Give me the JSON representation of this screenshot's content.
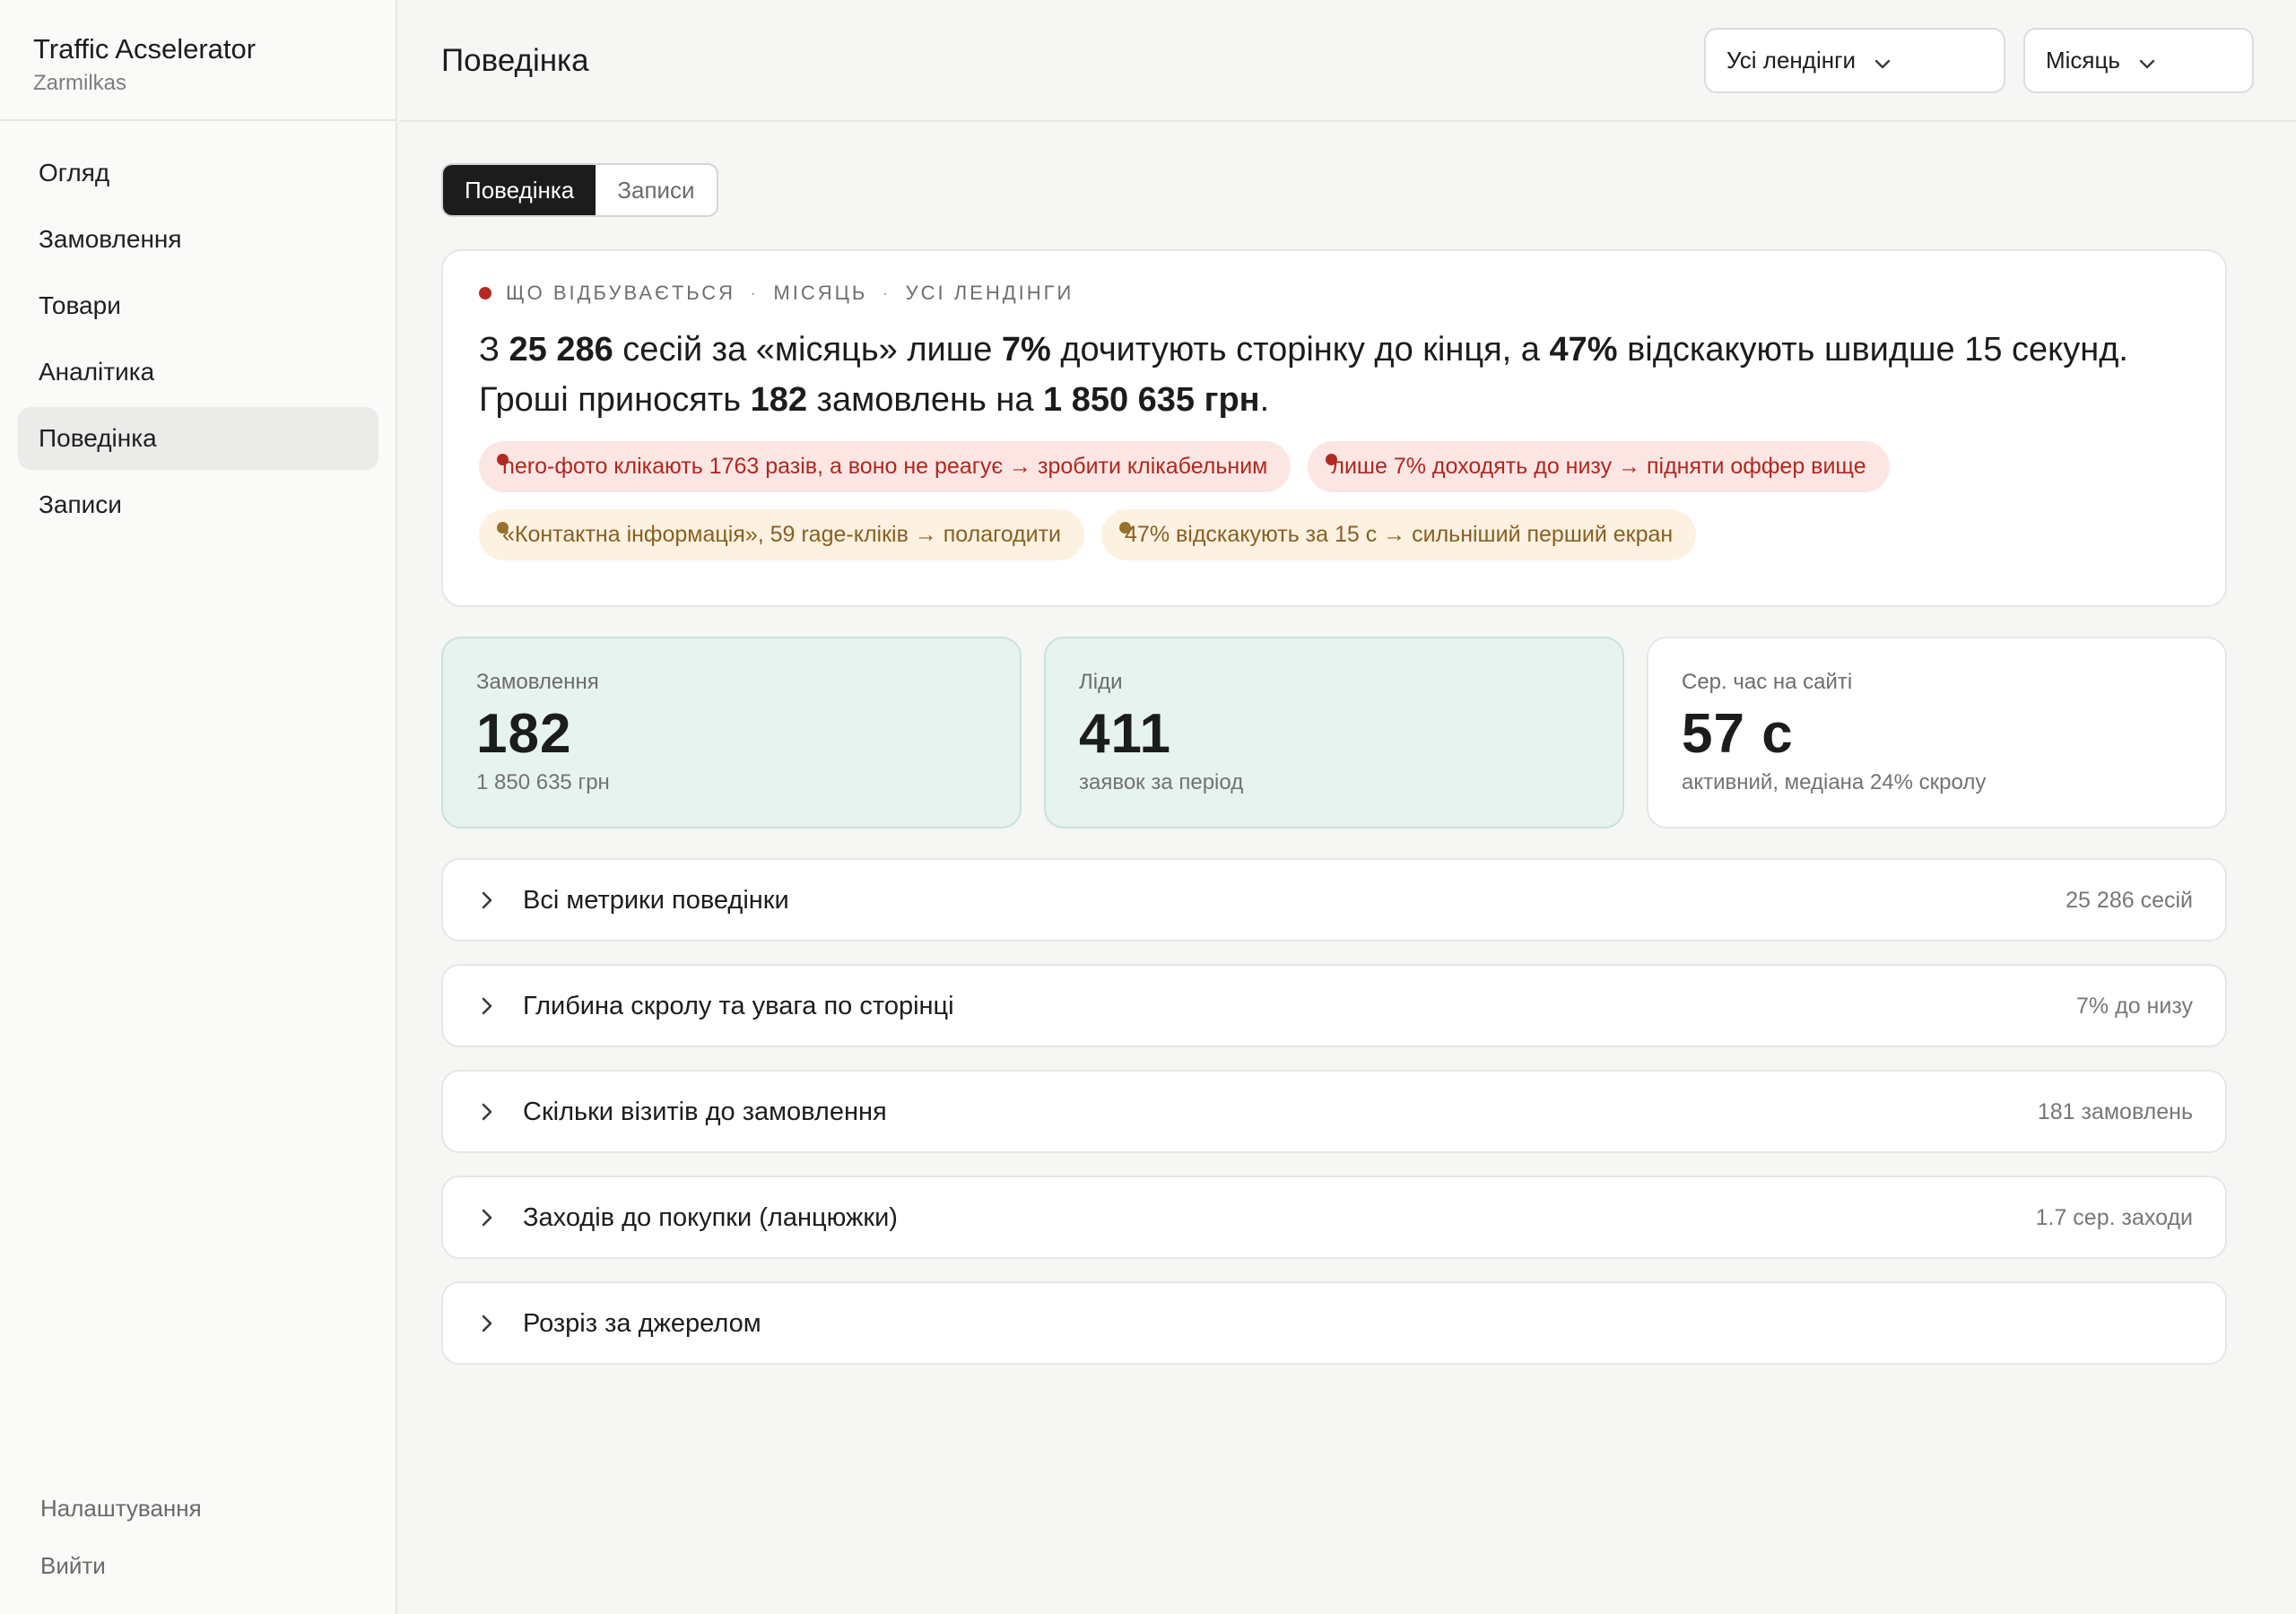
{
  "app": {
    "title": "Traffic Acselerator",
    "subtitle": "Zarmilkas"
  },
  "sidebar": {
    "items": [
      {
        "label": "Огляд",
        "active": false
      },
      {
        "label": "Замовлення",
        "active": false
      },
      {
        "label": "Товари",
        "active": false
      },
      {
        "label": "Аналітика",
        "active": false
      },
      {
        "label": "Поведінка",
        "active": true
      },
      {
        "label": "Записи",
        "active": false
      }
    ],
    "footer": {
      "settings": "Налаштування",
      "logout": "Вийти"
    }
  },
  "header": {
    "title": "Поведінка",
    "landing_select": "Усі лендінги",
    "period_select": "Місяць"
  },
  "tabs": [
    {
      "label": "Поведінка",
      "active": true
    },
    {
      "label": "Записи",
      "active": false
    }
  ],
  "summary": {
    "eyebrow": [
      "ЩО ВІДБУВАЄТЬСЯ",
      "МІСЯЦЬ",
      "УСІ ЛЕНДІНГИ"
    ],
    "headline": {
      "p1": "З ",
      "sessions": "25 286",
      "p2": " сесій за «місяць» лише ",
      "read_pct": "7%",
      "p3": " дочитують сторінку до кінця, а ",
      "bounce_pct": "47%",
      "p4": " відскакують швидше 15 секунд. Гроші приносять ",
      "orders": "182",
      "p5": " замовлень на ",
      "revenue": "1 850 635 грн",
      "p6": "."
    },
    "chips": [
      {
        "text": "hero-фото клікають 1763 разів, а воно не реагує → зробити клікабельним",
        "tone": "red"
      },
      {
        "text": "лише 7% доходять до низу → підняти оффер вище",
        "tone": "red"
      },
      {
        "text": "«Контактна інформація», 59 rage-кліків → полагодити",
        "tone": "amber"
      },
      {
        "text": "47% відскакують за 15 с → сильніший перший екран",
        "tone": "amber"
      }
    ]
  },
  "kpis": [
    {
      "label": "Замовлення",
      "value": "182",
      "sub": "1 850 635 грн",
      "tone": "green"
    },
    {
      "label": "Ліди",
      "value": "411",
      "sub": "заявок за період",
      "tone": "green"
    },
    {
      "label": "Сер. час на сайті",
      "value": "57 с",
      "sub": "активний, медіана 24% скролу",
      "tone": "white"
    }
  ],
  "sections": [
    {
      "title": "Всі метрики поведінки",
      "meta": "25 286 сесій"
    },
    {
      "title": "Глибина скролу та увага по сторінці",
      "meta": "7% до низу"
    },
    {
      "title": "Скільки візитів до замовлення",
      "meta": "181 замовлень"
    },
    {
      "title": "Заходів до покупки (ланцюжки)",
      "meta": "1.7 сер. заходи"
    },
    {
      "title": "Розріз за джерелом",
      "meta": ""
    }
  ],
  "colors": {
    "accent_dark": "#1c1c1c",
    "alert_red": "#b32a22",
    "warn_amber": "#97702b",
    "kpi_green_bg": "#e7f3ef"
  },
  "icons": {
    "select": "chevron-down-icon",
    "section": "chevron-right-icon",
    "status": "status-dot-icon"
  }
}
